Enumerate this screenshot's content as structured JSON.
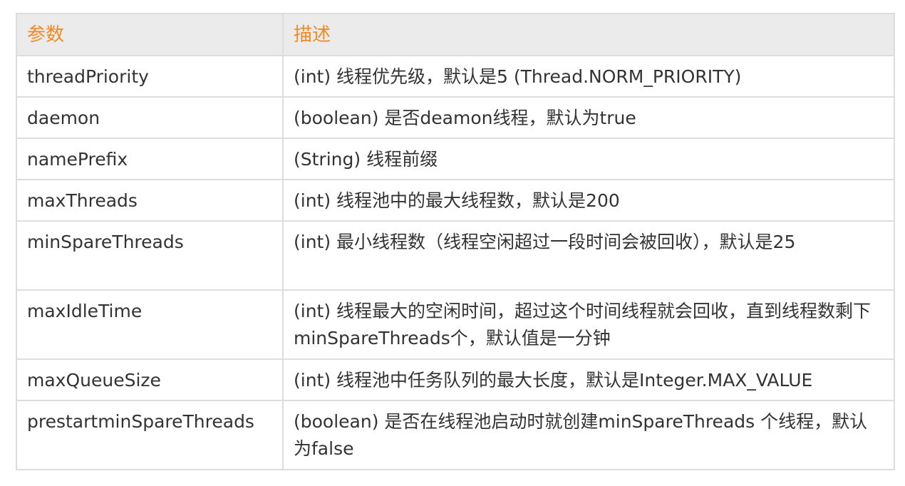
{
  "table": {
    "headers": [
      "参数",
      "描述"
    ],
    "rows": [
      {
        "param": "threadPriority",
        "desc": "(int) 线程优先级，默认是5 (Thread.NORM_PRIORITY)"
      },
      {
        "param": "daemon",
        "desc": "(boolean) 是否deamon线程，默认为true"
      },
      {
        "param": "namePrefix",
        "desc": "(String) 线程前缀"
      },
      {
        "param": "maxThreads",
        "desc": "(int) 线程池中的最大线程数，默认是200"
      },
      {
        "param": "minSpareThreads",
        "desc": "(int) 最小线程数（线程空闲超过一段时间会被回收），默认是25"
      },
      {
        "param": "maxIdleTime",
        "desc": "(int) 线程最大的空闲时间，超过这个时间线程就会回收，直到线程数剩下minSpareThreads个，默认值是一分钟"
      },
      {
        "param": "maxQueueSize",
        "desc": "(int) 线程池中任务队列的最大长度，默认是Integer.MAX_VALUE"
      },
      {
        "param": "prestartminSpareThreads",
        "desc": "(boolean) 是否在线程池启动时就创建minSpareThreads 个线程，默认为false"
      }
    ]
  },
  "colors": {
    "header_text": "#f08a24",
    "header_bg": "#ebebeb",
    "border": "#dddddd",
    "body_text": "#333333"
  }
}
